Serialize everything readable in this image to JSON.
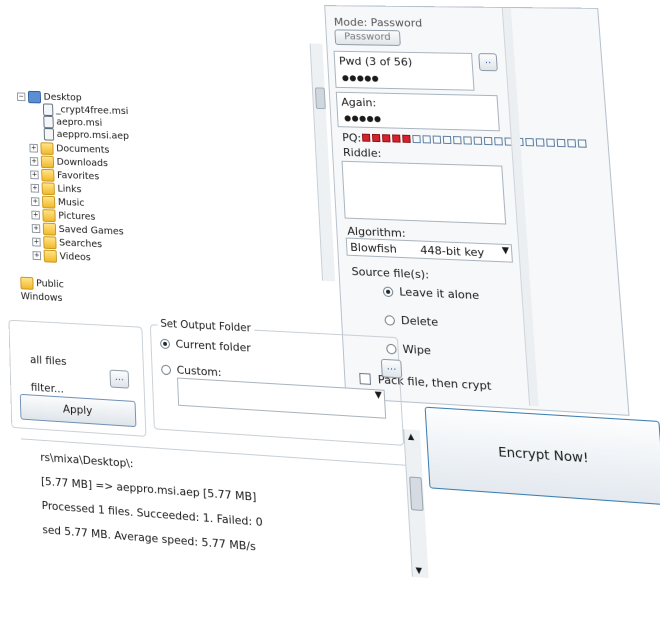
{
  "tree": {
    "root": "Desktop",
    "children": [
      {
        "label": "_crypt4free.msi",
        "type": "file"
      },
      {
        "label": "aepro.msi",
        "type": "file"
      },
      {
        "label": "aeppro.msi.aep",
        "type": "file"
      }
    ],
    "folders": [
      "Documents",
      "Downloads",
      "Favorites",
      "Links",
      "Music",
      "Pictures",
      "Saved Games",
      "Searches",
      "Videos"
    ],
    "bottom": [
      "Public",
      "Windows"
    ]
  },
  "right_panel": {
    "mode_label": "Mode: Password",
    "password_button": "Password",
    "pwd_label": "Pwd (3 of 56)",
    "pwd_value": "●●●●●",
    "browse_label": "..",
    "again_label": "Again:",
    "again_value": "●●●●●",
    "pq_label": "PQ:",
    "pq_filled": 5,
    "pq_total": 22,
    "riddle_label": "Riddle:",
    "algorithm_label": "Algorithm:",
    "algorithm_name": "Blowfish",
    "algorithm_key": "448-bit key",
    "source_label": "Source file(s):",
    "source_options": [
      "Leave it alone",
      "Delete",
      "Wipe"
    ],
    "source_selected": 0,
    "pack_label": "Pack file, then crypt",
    "encrypt_button": "Encrypt Now!"
  },
  "filter": {
    "all_files": "all files",
    "filter_label": "filter...",
    "filter_browse": "...",
    "apply_button": "Apply"
  },
  "output_folder": {
    "title": "Set Output Folder",
    "current": "Current folder",
    "custom": "Custom:",
    "browse": "...",
    "selected": 0
  },
  "log": {
    "lines": [
      "rs\\mixa\\Desktop\\:",
      "[5.77 MB] => aeppro.msi.aep [5.77 MB]",
      "Processed 1 files. Succeeded: 1. Failed: 0",
      "sed 5.77 MB. Average speed: 5.77 MB/s"
    ]
  },
  "colors": {
    "accent_border": "#b8c2cc",
    "pq_on": "#d3242c",
    "button_top": "#fbfcfd",
    "button_bottom": "#dfe5ea"
  }
}
